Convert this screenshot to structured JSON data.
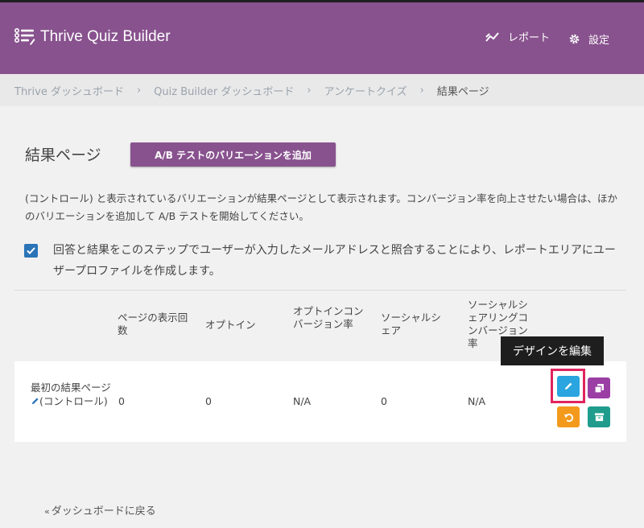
{
  "header": {
    "app_title": "Thrive Quiz Builder",
    "report_label": "レポート",
    "settings_label": "設定",
    "brand_color": "#88528e"
  },
  "breadcrumb": {
    "items": [
      "Thrive ダッシュボード",
      "Quiz Builder ダッシュボード",
      "アンケートクイズ"
    ],
    "separator": "›",
    "current": "結果ページ"
  },
  "main": {
    "title": "結果ページ",
    "ab_button_label": "A/B テストのバリエーションを追加",
    "description": "(コントロール) と表示されているバリエーションが結果ページとして表示されます。コンバージョン率を向上させたい場合は、ほかのバリエーションを追加して A/B テストを開始してください。",
    "checkbox_checked": true,
    "checkbox_label": "回答と結果をこのステップでユーザーが入力したメールアドレスと照合することにより、レポートエリアにユーザープロファイルを作成します。"
  },
  "table": {
    "headers": [
      "ページの表示回数",
      "オプトイン",
      "オプトインコンバージョン率",
      "ソーシャルシェア",
      "ソーシャルシェアリングコンバージョン率"
    ],
    "rows": [
      {
        "name": "最初の結果ページ",
        "name_suffix": "(コントロール)",
        "views": "0",
        "optins": "0",
        "optin_rate": "N/A",
        "shares": "0",
        "share_rate": "N/A"
      }
    ],
    "actions": [
      "edit-design",
      "duplicate",
      "reset",
      "archive"
    ]
  },
  "tooltip": "デザインを編集",
  "footer": {
    "back_label": "ダッシュボードに戻る"
  }
}
